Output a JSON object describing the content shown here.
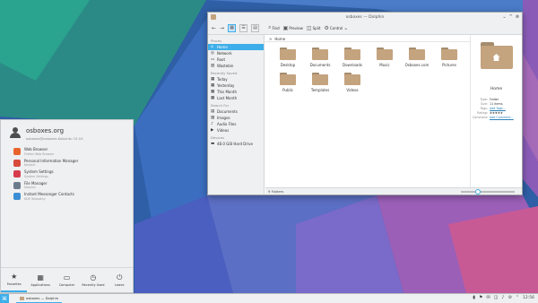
{
  "window": {
    "title": "osboxes — Dolphin",
    "minimize_glyph": "⌄",
    "maximize_glyph": "^",
    "close_glyph": "⊗"
  },
  "toolbar": {
    "back_glyph": "←",
    "forward_glyph": "→",
    "find": "Find",
    "preview": "Preview",
    "split": "Split",
    "control": "Control"
  },
  "sidebar": {
    "places_header": "Places",
    "places": [
      {
        "label": "Home",
        "icon": "home-icon",
        "selected": true
      },
      {
        "label": "Network",
        "icon": "network-icon"
      },
      {
        "label": "Root",
        "icon": "root-icon"
      },
      {
        "label": "Wastebin",
        "icon": "trash-icon"
      }
    ],
    "recent_header": "Recently Saved",
    "recent": [
      {
        "label": "Today",
        "icon": "calendar-icon"
      },
      {
        "label": "Yesterday",
        "icon": "calendar-icon"
      },
      {
        "label": "This Month",
        "icon": "calendar-icon"
      },
      {
        "label": "Last Month",
        "icon": "calendar-icon"
      }
    ],
    "search_header": "Search For",
    "search": [
      {
        "label": "Documents",
        "icon": "document-icon"
      },
      {
        "label": "Images",
        "icon": "image-icon"
      },
      {
        "label": "Audio Files",
        "icon": "audio-icon"
      },
      {
        "label": "Videos",
        "icon": "video-icon"
      }
    ],
    "devices_header": "Devices",
    "devices": [
      {
        "label": "48.0 GiB Hard Drive",
        "icon": "harddrive-icon"
      }
    ]
  },
  "breadcrumb": {
    "root_glyph": ">",
    "current": "Home"
  },
  "files": [
    "Desktop",
    "Documents",
    "Downloads",
    "Music",
    "Osboxes.com",
    "Pictures",
    "Public",
    "Templates",
    "Videos"
  ],
  "info": {
    "name": "Home",
    "meta": [
      {
        "k": "Type:",
        "v": "Folder"
      },
      {
        "k": "Size:",
        "v": "11 items"
      },
      {
        "k": "Tags:",
        "v": "Add Tags..."
      },
      {
        "k": "Rating:",
        "v": "★★★★★"
      },
      {
        "k": "Comment:",
        "v": "Add Comment..."
      }
    ]
  },
  "status": {
    "text": "9 Folders",
    "zoom_fraction": 0.3
  },
  "kickoff": {
    "username": "osboxes.org",
    "userhost": "osboxes@osboxes.Kubuntu 15.04",
    "apps": [
      {
        "name": "Web Browser",
        "desc": "Firefox Web Browser",
        "color": "#e8632b",
        "icon": "firefox-icon"
      },
      {
        "name": "Personal Information Manager",
        "desc": "Kontact",
        "color": "#d84a3c",
        "icon": "kontact-icon"
      },
      {
        "name": "System Settings",
        "desc": "System Settings",
        "color": "#d63c4d",
        "icon": "settings-icon"
      },
      {
        "name": "File Manager",
        "desc": "Dolphin",
        "color": "#6b7b8c",
        "icon": "dolphin-icon"
      },
      {
        "name": "Instant Messenger Contacts",
        "desc": "KDE Telepathy",
        "color": "#3b8ed4",
        "icon": "messenger-icon"
      }
    ],
    "tabs": [
      {
        "label": "Favorites",
        "glyph": "★",
        "active": true
      },
      {
        "label": "Applications",
        "glyph": "▦"
      },
      {
        "label": "Computer",
        "glyph": "▭"
      },
      {
        "label": "Recently Used",
        "glyph": "◷"
      },
      {
        "label": "Leave",
        "glyph": "⏻"
      }
    ]
  },
  "panel": {
    "launcher_glyph": "⌘",
    "task_label": "osboxes — Dolphin",
    "clock": "12:56",
    "tray_glyphs": [
      "▮",
      "⚑",
      "✉",
      "◫",
      "♪",
      "⊘",
      "⌃"
    ]
  }
}
